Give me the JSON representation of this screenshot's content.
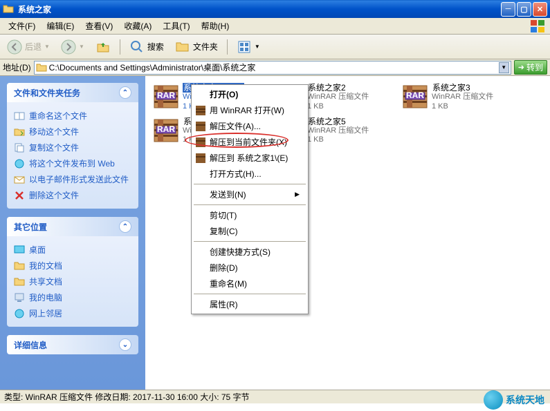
{
  "titlebar": {
    "title": "系统之家"
  },
  "menu": {
    "file": "文件(F)",
    "edit": "编辑(E)",
    "view": "查看(V)",
    "fav": "收藏(A)",
    "tools": "工具(T)",
    "help": "帮助(H)"
  },
  "toolbar": {
    "back": "后退",
    "search": "搜索",
    "folders": "文件夹"
  },
  "addressbar": {
    "label": "地址(D)",
    "path": "C:\\Documents and Settings\\Administrator\\桌面\\系统之家",
    "go": "转到"
  },
  "sidebar": {
    "tasks": {
      "title": "文件和文件夹任务",
      "items": [
        "重命名这个文件",
        "移动这个文件",
        "复制这个文件",
        "将这个文件发布到 Web",
        "以电子邮件形式发送此文件",
        "删除这个文件"
      ]
    },
    "other": {
      "title": "其它位置",
      "items": [
        "桌面",
        "我的文档",
        "共享文档",
        "我的电脑",
        "网上邻居"
      ]
    },
    "details": {
      "title": "详细信息"
    }
  },
  "files": [
    {
      "name": "系统之家1",
      "type": "WinRAR 压缩文件",
      "size": "1 KB",
      "selected": true
    },
    {
      "name": "系统之家2",
      "type": "WinRAR 压缩文件",
      "size": "1 KB"
    },
    {
      "name": "系统之家3",
      "type": "WinRAR 压缩文件",
      "size": "1 KB"
    },
    {
      "name": "系统之家4",
      "type": "WinRAR 压缩文件",
      "size": "1 KB"
    },
    {
      "name": "系统之家5",
      "type": "WinRAR 压缩文件",
      "size": "1 KB"
    }
  ],
  "contextmenu": {
    "open": "打开(O)",
    "openwith_rar": "用 WinRAR 打开(W)",
    "extract_files": "解压文件(A)...",
    "extract_here": "解压到当前文件夹(X)",
    "extract_to": "解压到 系统之家1\\(E)",
    "openwith": "打开方式(H)...",
    "sendto": "发送到(N)",
    "cut": "剪切(T)",
    "copy": "复制(C)",
    "shortcut": "创建快捷方式(S)",
    "delete": "删除(D)",
    "rename": "重命名(M)",
    "properties": "属性(R)"
  },
  "statusbar": {
    "text": "类型: WinRAR 压缩文件 修改日期: 2017-11-30 16:00 大小: 75 字节"
  },
  "watermark": {
    "text": "系统天地"
  }
}
